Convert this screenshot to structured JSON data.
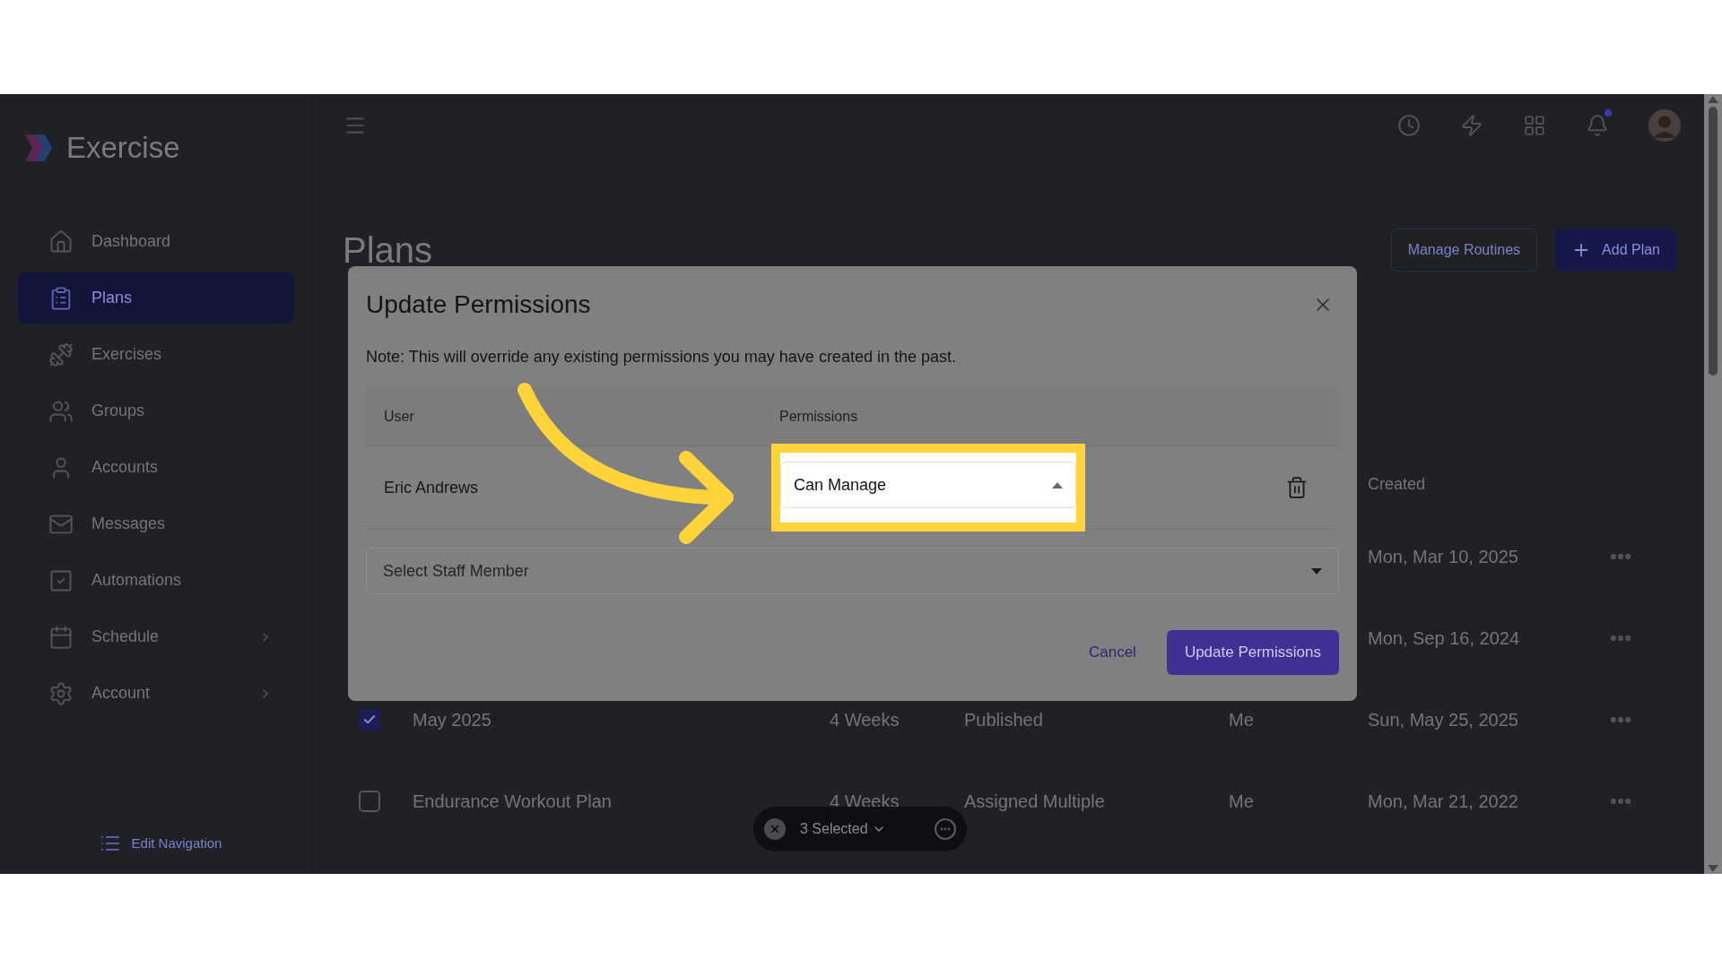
{
  "app": {
    "name": "Exercise"
  },
  "sidebar": {
    "items": [
      {
        "label": "Dashboard",
        "selected": false,
        "has_submenu": false
      },
      {
        "label": "Plans",
        "selected": true,
        "has_submenu": false
      },
      {
        "label": "Exercises",
        "selected": false,
        "has_submenu": false
      },
      {
        "label": "Groups",
        "selected": false,
        "has_submenu": false
      },
      {
        "label": "Accounts",
        "selected": false,
        "has_submenu": false
      },
      {
        "label": "Messages",
        "selected": false,
        "has_submenu": false
      },
      {
        "label": "Automations",
        "selected": false,
        "has_submenu": false
      },
      {
        "label": "Schedule",
        "selected": false,
        "has_submenu": true
      },
      {
        "label": "Account",
        "selected": false,
        "has_submenu": true
      }
    ],
    "edit_navigation": "Edit Navigation"
  },
  "page": {
    "title": "Plans",
    "buttons": [
      {
        "label": "Manage Routines",
        "kind": "outline"
      },
      {
        "label": "Add Plan",
        "kind": "primary"
      }
    ]
  },
  "table": {
    "created_header": "Created",
    "rows": [
      {
        "created": "Mon, Mar 10, 2025"
      },
      {
        "created": "Mon, Sep 16, 2024"
      },
      {
        "checked": true,
        "name": "May 2025",
        "duration": "4 Weeks",
        "status": "Published",
        "owner": "Me",
        "created": "Sun, May 25, 2025"
      },
      {
        "checked": false,
        "name": "Endurance Workout Plan",
        "duration": "4 Weeks",
        "status": "Assigned Multiple",
        "owner": "Me",
        "created": "Mon, Mar 21, 2022"
      }
    ]
  },
  "selection_bar": {
    "label": "3 Selected"
  },
  "dialog": {
    "title": "Update Permissions",
    "note": "Note: This will override any existing permissions you may have created in the past.",
    "columns": [
      "User",
      "Permissions"
    ],
    "rows": [
      {
        "user": "Eric Andrews",
        "permission": "Can Manage",
        "expanded": true
      }
    ],
    "staff_select": {
      "placeholder": "Select Staff Member"
    },
    "buttons": {
      "cancel": "Cancel",
      "confirm": "Update Permissions"
    }
  }
}
